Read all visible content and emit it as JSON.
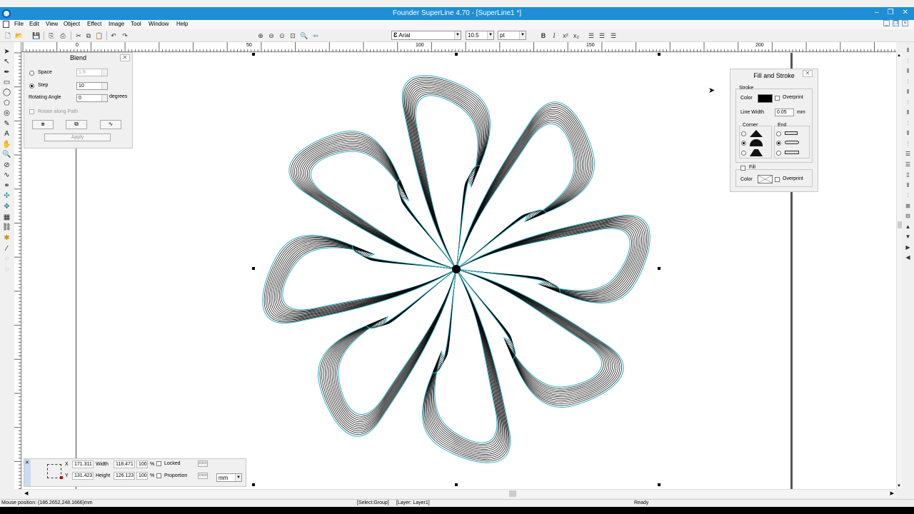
{
  "window": {
    "title": "Founder SuperLine 4.70 - [SuperLine1 *]",
    "min": "–",
    "max": "❐",
    "close": "✕"
  },
  "menu": [
    "File",
    "Edit",
    "View",
    "Object",
    "Effect",
    "Image",
    "Tool",
    "Window",
    "Help"
  ],
  "font_bar": {
    "font": "Arial",
    "size": "10.5",
    "unit": "pt",
    "bold": "B",
    "italic": "I"
  },
  "ruler": {
    "marks": [
      "0",
      "50",
      "100",
      "150",
      "200"
    ]
  },
  "blend_panel": {
    "title": "Blend",
    "space_label": "Space",
    "space_value": "1.5",
    "step_label": "Step",
    "step_value": "10",
    "angle_label": "Rotating Angle",
    "angle_value": "0",
    "angle_unit": "degrees",
    "along_path_label": "Rotate along Path",
    "apply_label": "Apply",
    "mode": "step"
  },
  "fill_stroke_panel": {
    "title": "Fill and Stroke",
    "stroke_group": "Stroke",
    "color_label": "Color",
    "stroke_color": "#000000",
    "overprint_label": "Overprint",
    "line_width_label": "Line Width",
    "line_width_value": "0.05",
    "line_width_unit": "mm",
    "corner_group": "Corner",
    "end_group": "End",
    "fill_label": "Fill",
    "fill_color_label": "Color",
    "fill_overprint_label": "Overprint"
  },
  "transform_panel": {
    "x_label": "X",
    "x_value": "171.311",
    "y_label": "Y",
    "y_value": "131.423",
    "width_label": "Width",
    "width_value": "118.471",
    "height_label": "Height",
    "height_value": "126.123",
    "width_pct": "100",
    "height_pct": "100",
    "pct_symbol": "%",
    "locked_label": "Locked",
    "proportion_label": "Proportion",
    "unit": "mm"
  },
  "status": {
    "mouse": "Mouse position: (186.2652,248.1666)mm",
    "selection": "[Select:Group]",
    "layer": "[Layer: Layer1]",
    "state": "Ready"
  },
  "colors": {
    "titlebar": "#1e8fd6",
    "accent_line": "#2ab0c8"
  }
}
